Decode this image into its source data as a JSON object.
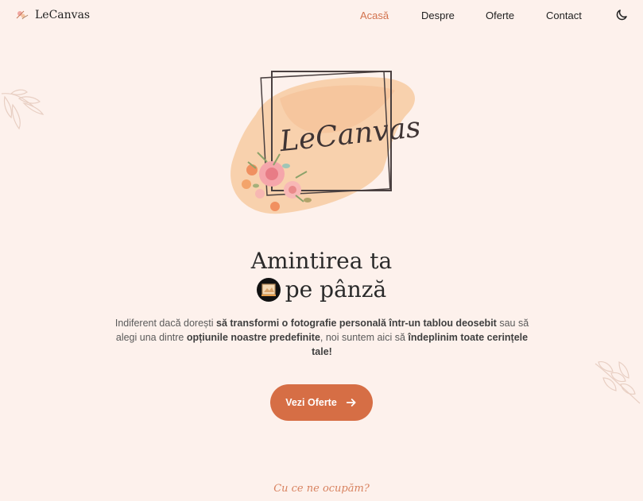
{
  "nav": {
    "brand": "LeCanvas",
    "links": [
      "Acasă",
      "Despre",
      "Oferte",
      "Contact"
    ],
    "active_index": 0,
    "theme_icon": "moon-icon"
  },
  "hero": {
    "logo_text": "LeCanvas",
    "title_line1": "Amintirea ta",
    "title_line2": "pe pânză",
    "emoji_icon": "canvas-frame-emoji",
    "description": {
      "p1_normal1": "Indiferent dacă dorești ",
      "p1_bold1": "să transformi o fotografie personală într-un tablou deosebit",
      "p1_normal2": " sau să alegi una dintre ",
      "p1_bold2": "opțiunile noastre predefinite",
      "p1_normal3": ", noi suntem aici să ",
      "p1_bold3": "îndeplinim toate cerințele tale!"
    },
    "cta_label": "Vezi Oferte",
    "cta_icon": "arrow-right-icon"
  },
  "section": {
    "kicker": "Cu ce ne ocupăm?"
  },
  "colors": {
    "background": "#fdf1ec",
    "accent": "#d66e45",
    "active_link": "#d2724d"
  }
}
